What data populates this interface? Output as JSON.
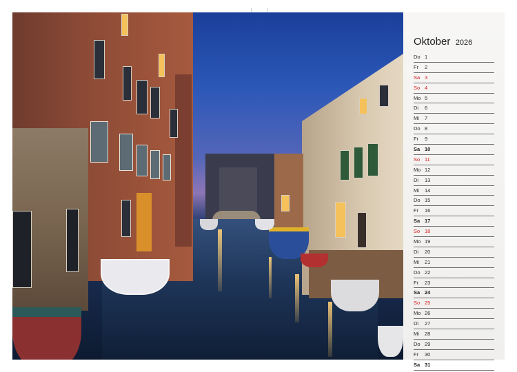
{
  "calendar": {
    "month": "Oktober",
    "year": "2026",
    "days": [
      {
        "weekday": "Do",
        "day": "1",
        "type": "work"
      },
      {
        "weekday": "Fr",
        "day": "2",
        "type": "work"
      },
      {
        "weekday": "Sa",
        "day": "3",
        "type": "holiday"
      },
      {
        "weekday": "So",
        "day": "4",
        "type": "holiday"
      },
      {
        "weekday": "Mo",
        "day": "5",
        "type": "work"
      },
      {
        "weekday": "Di",
        "day": "6",
        "type": "work"
      },
      {
        "weekday": "Mi",
        "day": "7",
        "type": "work"
      },
      {
        "weekday": "Do",
        "day": "8",
        "type": "work"
      },
      {
        "weekday": "Fr",
        "day": "9",
        "type": "work"
      },
      {
        "weekday": "Sa",
        "day": "10",
        "type": "weekend"
      },
      {
        "weekday": "So",
        "day": "11",
        "type": "holiday"
      },
      {
        "weekday": "Mo",
        "day": "12",
        "type": "work"
      },
      {
        "weekday": "Di",
        "day": "13",
        "type": "work"
      },
      {
        "weekday": "Mi",
        "day": "14",
        "type": "work"
      },
      {
        "weekday": "Do",
        "day": "15",
        "type": "work"
      },
      {
        "weekday": "Fr",
        "day": "16",
        "type": "work"
      },
      {
        "weekday": "Sa",
        "day": "17",
        "type": "weekend"
      },
      {
        "weekday": "So",
        "day": "18",
        "type": "holiday"
      },
      {
        "weekday": "Mo",
        "day": "19",
        "type": "work"
      },
      {
        "weekday": "Di",
        "day": "20",
        "type": "work"
      },
      {
        "weekday": "Mi",
        "day": "21",
        "type": "work"
      },
      {
        "weekday": "Do",
        "day": "22",
        "type": "work"
      },
      {
        "weekday": "Fr",
        "day": "23",
        "type": "work"
      },
      {
        "weekday": "Sa",
        "day": "24",
        "type": "weekend"
      },
      {
        "weekday": "So",
        "day": "25",
        "type": "holiday"
      },
      {
        "weekday": "Mo",
        "day": "26",
        "type": "work"
      },
      {
        "weekday": "Di",
        "day": "27",
        "type": "work"
      },
      {
        "weekday": "Mi",
        "day": "28",
        "type": "work"
      },
      {
        "weekday": "Do",
        "day": "29",
        "type": "work"
      },
      {
        "weekday": "Fr",
        "day": "30",
        "type": "work"
      },
      {
        "weekday": "Sa",
        "day": "31",
        "type": "weekend"
      }
    ]
  },
  "colors": {
    "holiday_text": "#d21f1f",
    "binding_dots": "#8a8a8a",
    "calendar_panel": "#f4f3f1"
  }
}
